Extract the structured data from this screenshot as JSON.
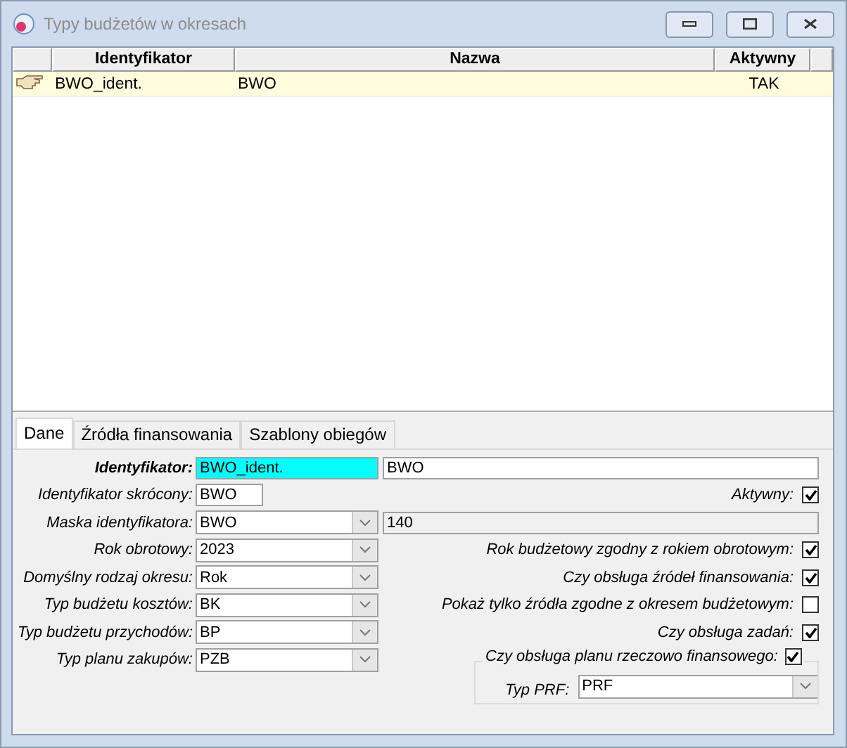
{
  "window": {
    "title": "Typy budżetów w okresach"
  },
  "table": {
    "columns": [
      "Identyfikator",
      "Nazwa",
      "Aktywny"
    ],
    "rows": [
      {
        "cells": [
          "BWO_ident.",
          "BWO",
          "TAK"
        ],
        "selected": true
      }
    ]
  },
  "tabs": [
    {
      "label": "Dane",
      "selected": true
    },
    {
      "label": "Źródła finansowania",
      "selected": false
    },
    {
      "label": "Szablony obiegów",
      "selected": false
    }
  ],
  "form": {
    "rows": [
      {
        "label": "Identyfikator:",
        "required": true,
        "kind": "text",
        "value": "BWO_ident.",
        "focused": true,
        "extra": {
          "value": "BWO",
          "disabled": false
        }
      },
      {
        "label": "Identyfikator skrócony:",
        "required": false,
        "kind": "short",
        "value": "BWO",
        "focused": false,
        "check": {
          "label": "Aktywny:",
          "checked": true
        }
      },
      {
        "label": "Maska identyfikatora:",
        "required": false,
        "kind": "combo",
        "value": "BWO",
        "focused": false,
        "extra": {
          "value": "140",
          "disabled": true
        }
      },
      {
        "label": "Rok obrotowy:",
        "required": false,
        "kind": "combo",
        "value": "2023",
        "focused": false,
        "check": {
          "label": "Rok budżetowy zgodny z rokiem obrotowym:",
          "checked": true
        }
      },
      {
        "label": "Domyślny rodzaj okresu:",
        "required": false,
        "kind": "combo",
        "value": "Rok",
        "focused": false,
        "check": {
          "label": "Czy obsługa źródeł finansowania:",
          "checked": true
        }
      },
      {
        "label": "Typ budżetu kosztów:",
        "required": false,
        "kind": "combo",
        "value": "BK",
        "focused": false,
        "check": {
          "label": "Pokaż tylko źródła zgodne z okresem budżetowym:",
          "checked": false
        }
      },
      {
        "label": "Typ budżetu przychodów:",
        "required": false,
        "kind": "combo",
        "value": "BP",
        "focused": false,
        "check": {
          "label": "Czy obsługa zadań:",
          "checked": true
        }
      },
      {
        "label": "Typ planu zakupów:",
        "required": false,
        "kind": "combo",
        "value": "PZB",
        "focused": false
      }
    ],
    "group": {
      "label": "Czy obsługa planu rzeczowo finansowego:",
      "checked": true,
      "field_label": "Typ PRF:",
      "value": "PRF"
    }
  }
}
